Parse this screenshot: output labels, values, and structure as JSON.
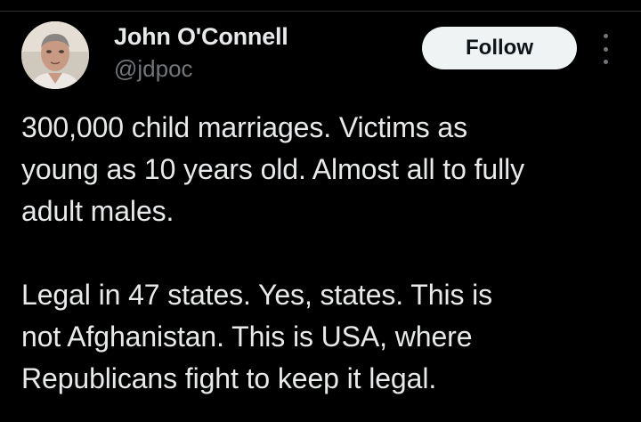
{
  "tweet": {
    "author": {
      "name": "John O'Connell",
      "handle": "@jdpoc",
      "avatar_icon": "profile-photo"
    },
    "follow_label": "Follow",
    "more_icon": "more-vertical-icon",
    "paragraphs": [
      "300,000 child marriages. Victims as\nyoung as 10 years old. Almost all to fully\nadult males.",
      "Legal in 47 states. Yes, states. This is\nnot Afghanistan. This is USA, where\nRepublicans fight to keep it legal."
    ]
  },
  "colors": {
    "background": "#000000",
    "text_primary": "#e7e9ea",
    "text_secondary": "#71767b",
    "button_bg": "#eff3f4",
    "button_text": "#0f1419"
  }
}
